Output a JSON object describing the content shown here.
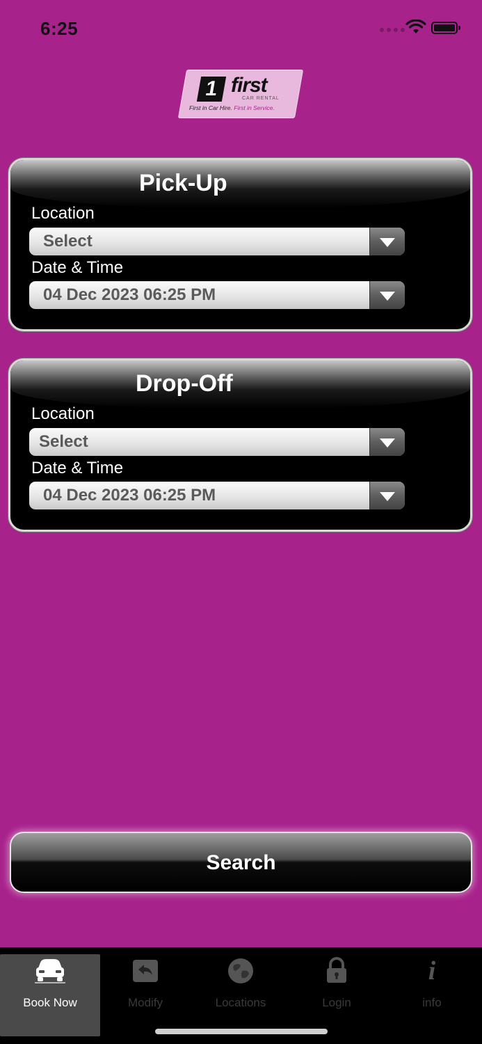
{
  "status_bar": {
    "time": "6:25"
  },
  "logo": {
    "brand": "first",
    "subtitle": "CAR RENTAL",
    "tagline_1": "First in Car Hire.",
    "tagline_2": "First in Service."
  },
  "pickup": {
    "title": "Pick-Up",
    "location_label": "Location",
    "location_value": "Select",
    "datetime_label": "Date & Time",
    "datetime_value": "04 Dec 2023 06:25 PM"
  },
  "dropoff": {
    "title": "Drop-Off",
    "location_label": "Location",
    "location_value": "Select",
    "datetime_label": "Date & Time",
    "datetime_value": "04 Dec 2023 06:25 PM"
  },
  "search": {
    "label": "Search"
  },
  "tabs": [
    {
      "label": "Book Now",
      "icon": "car-icon",
      "active": true
    },
    {
      "label": "Modify",
      "icon": "back-arrow-icon",
      "active": false
    },
    {
      "label": "Locations",
      "icon": "globe-icon",
      "active": false
    },
    {
      "label": "Login",
      "icon": "lock-icon",
      "active": false
    },
    {
      "label": "info",
      "icon": "info-icon",
      "active": false
    }
  ],
  "colors": {
    "background": "#a8228c",
    "panel": "#000000",
    "tabbar": "#000000"
  }
}
